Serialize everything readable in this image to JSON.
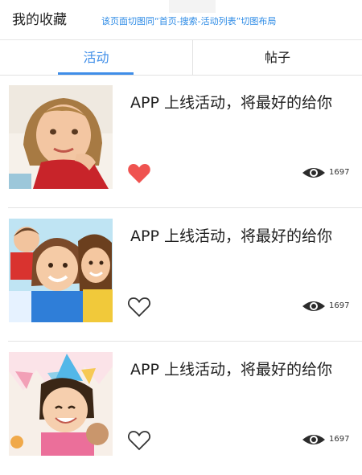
{
  "header": {
    "title": "我的收藏",
    "note": "该页面切图同“首页-搜索-活动列表”切图布局"
  },
  "tabs": [
    {
      "label": "活动",
      "active": true
    },
    {
      "label": "帖子",
      "active": false
    }
  ],
  "items": [
    {
      "title": "APP 上线活动，将最好的给你",
      "liked": true,
      "views": "1697"
    },
    {
      "title": "APP 上线活动，将最好的给你",
      "liked": false,
      "views": "1697"
    },
    {
      "title": "APP 上线活动，将最好的给你",
      "liked": false,
      "views": "1697"
    }
  ],
  "colors": {
    "accent": "#3f8ee8",
    "like": "#ef5350",
    "note": "#2d8be6"
  }
}
